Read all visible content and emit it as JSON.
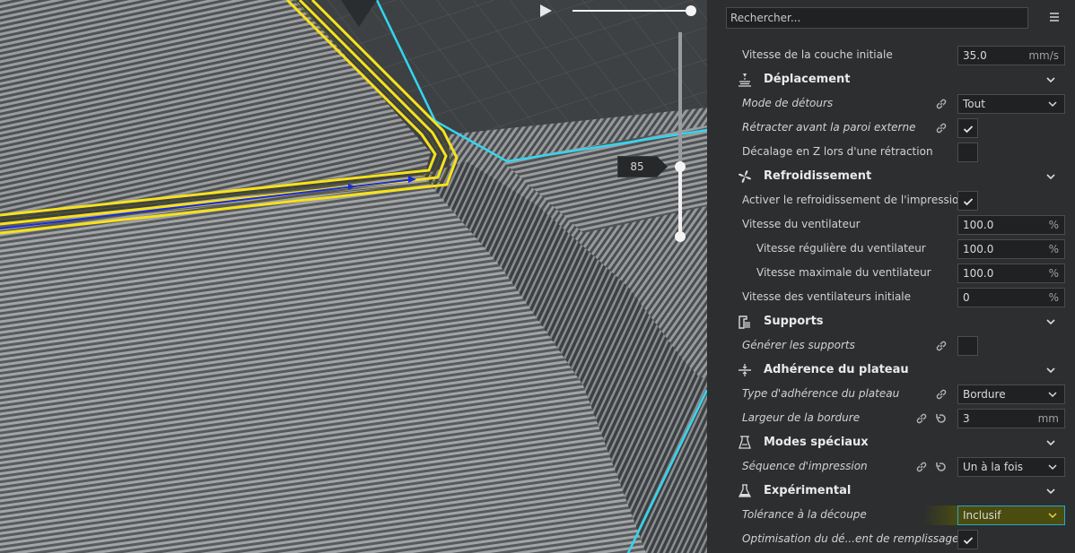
{
  "viewport": {
    "layer_label": "85",
    "colors": {
      "wall": "#9a9c9e",
      "outer_wall": "#f7e21a",
      "travel": "#1b2bd8",
      "outline": "#33d6f0"
    }
  },
  "search": {
    "placeholder": "Rechercher..."
  },
  "settings": {
    "initial_layer_speed": {
      "label": "Vitesse de la couche initiale",
      "value": "35.0",
      "unit": "mm/s"
    },
    "travel": {
      "title": "Déplacement",
      "combing_mode": {
        "label": "Mode de détours",
        "value": "Tout"
      },
      "retract_before_outer_wall": {
        "label": "Rétracter avant la paroi externe",
        "checked": true
      },
      "z_hop": {
        "label": "Décalage en Z lors d'une rétraction",
        "checked": false
      }
    },
    "cooling": {
      "title": "Refroidissement",
      "enable_cooling": {
        "label": "Activer le refroidissement de l'impression",
        "checked": true
      },
      "fan_speed": {
        "label": "Vitesse du ventilateur",
        "value": "100.0",
        "unit": "%"
      },
      "regular_fan_speed": {
        "label": "Vitesse régulière du ventilateur",
        "value": "100.0",
        "unit": "%"
      },
      "max_fan_speed": {
        "label": "Vitesse maximale du ventilateur",
        "value": "100.0",
        "unit": "%"
      },
      "initial_fan_speed": {
        "label": "Vitesse des ventilateurs initiale",
        "value": "0",
        "unit": "%"
      }
    },
    "support": {
      "title": "Supports",
      "generate_support": {
        "label": "Générer les supports",
        "checked": false
      }
    },
    "adhesion": {
      "title": "Adhérence du plateau",
      "adhesion_type": {
        "label": "Type d'adhérence du plateau",
        "value": "Bordure"
      },
      "brim_width": {
        "label": "Largeur de la bordure",
        "value": "3",
        "unit": "mm"
      }
    },
    "special": {
      "title": "Modes spéciaux",
      "print_sequence": {
        "label": "Séquence d'impression",
        "value": "Un à la fois"
      }
    },
    "experimental": {
      "title": "Expérimental",
      "slicing_tolerance": {
        "label": "Tolérance à la découpe",
        "value": "Inclusif"
      },
      "infill_optimization": {
        "label": "Optimisation du dé...ent de remplissage",
        "checked": true
      }
    }
  }
}
